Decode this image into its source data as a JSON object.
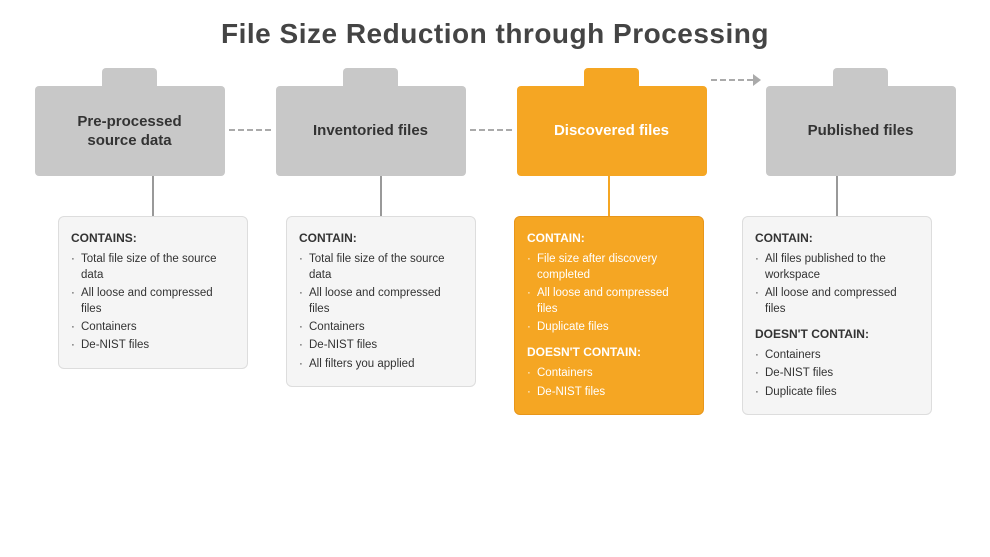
{
  "page": {
    "title": "File Size Reduction through Processing"
  },
  "folders": [
    {
      "id": "pre-processed",
      "label": "Pre-processed\nsource data",
      "color": "gray",
      "tab_color": "gray"
    },
    {
      "id": "inventoried",
      "label": "Inventoried files",
      "color": "gray",
      "tab_color": "gray"
    },
    {
      "id": "discovered",
      "label": "Discovered files",
      "color": "orange",
      "tab_color": "orange"
    },
    {
      "id": "published",
      "label": "Published files",
      "color": "gray",
      "tab_color": "gray"
    }
  ],
  "cards": [
    {
      "id": "pre-processed-card",
      "color": "gray",
      "sections": [
        {
          "type": "contains",
          "label": "CONTAINS:",
          "items": [
            "Total file size of the source data",
            "All loose and compressed files",
            "Containers",
            "De-NIST files"
          ]
        }
      ]
    },
    {
      "id": "inventoried-card",
      "color": "gray",
      "sections": [
        {
          "type": "contain",
          "label": "CONTAIN:",
          "items": [
            "Total file size of the source data",
            "All loose and compressed files",
            "Containers",
            "De-NIST files",
            "All filters you applied"
          ]
        }
      ]
    },
    {
      "id": "discovered-card",
      "color": "orange",
      "sections": [
        {
          "type": "contain",
          "label": "CONTAIN:",
          "items": [
            "File size after discovery completed",
            "All loose and compressed files",
            "Duplicate files"
          ]
        },
        {
          "type": "doesnt_contain",
          "label": "DOESN'T CONTAIN:",
          "items": [
            "Containers",
            "De-NIST files"
          ]
        }
      ]
    },
    {
      "id": "published-card",
      "color": "gray",
      "sections": [
        {
          "type": "contain",
          "label": "CONTAIN:",
          "items": [
            "All files published to the workspace",
            "All loose and compressed files"
          ]
        },
        {
          "type": "doesnt_contain",
          "label": "DOESN'T CONTAIN:",
          "items": [
            "Containers",
            "De-NIST files",
            "Duplicate files"
          ]
        }
      ]
    }
  ],
  "colors": {
    "gray_folder": "#c8c8c8",
    "orange_folder": "#f5a623",
    "card_gray_bg": "#f0f0f0",
    "card_gray_border": "#d0d0d0",
    "text_dark": "#333333",
    "arrow_color": "#999999"
  }
}
